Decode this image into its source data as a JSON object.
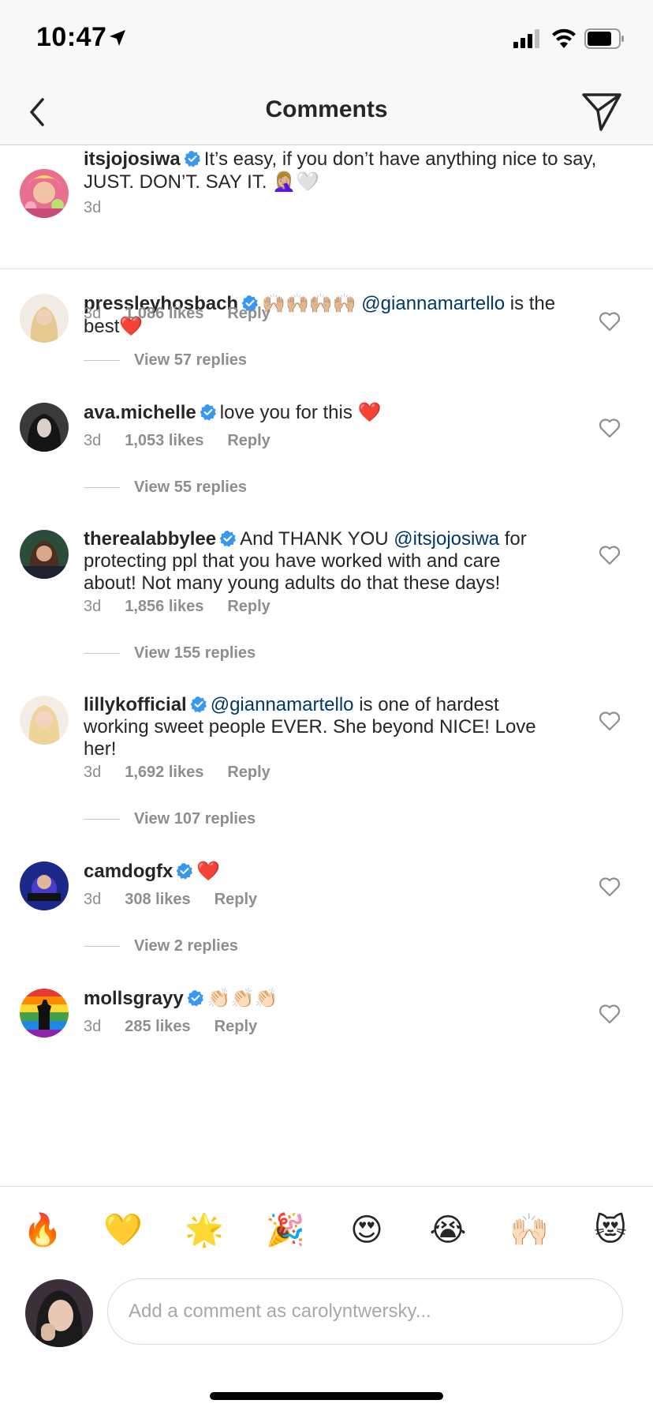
{
  "status_bar": {
    "time": "10:47"
  },
  "nav": {
    "title": "Comments"
  },
  "caption": {
    "username": "itsjojosiwa",
    "text": "It’s easy, if you don’t have anything nice to say, JUST. DON’T. SAY IT.",
    "emoji": "🤦🏼‍♀️🤍",
    "time": "3d"
  },
  "comments": [
    {
      "username": "pressleyhosbach",
      "emoji_lead": "🙌🏼🙌🏼🙌🏼🙌🏼",
      "mention": "@giannamartello",
      "text_after": "is the best",
      "emoji_trail": "❤️",
      "time": "3d",
      "likes": "1,086 likes",
      "reply": "Reply",
      "replies": "View 57 replies"
    },
    {
      "username": "ava.michelle",
      "text": "love you for this",
      "emoji_trail": "❤️",
      "time": "3d",
      "likes": "1,053 likes",
      "reply": "Reply",
      "replies": "View 55 replies"
    },
    {
      "username": "therealabbylee",
      "text_before": "And THANK YOU",
      "mention": "@itsjojosiwa",
      "text_after": "for protecting ppl that you have worked with and care about! Not many young adults do that these days!",
      "time": "3d",
      "likes": "1,856 likes",
      "reply": "Reply",
      "replies": "View 155 replies"
    },
    {
      "username": "lillykofficial",
      "mention": "@giannamartello",
      "text_after": "is one of hardest working sweet people EVER. She beyond NICE! Love her!",
      "time": "3d",
      "likes": "1,692 likes",
      "reply": "Reply",
      "replies": "View 107 replies"
    },
    {
      "username": "camdogfx",
      "emoji_trail": "❤️",
      "time": "3d",
      "likes": "308 likes",
      "reply": "Reply",
      "replies": "View 2 replies"
    },
    {
      "username": "mollsgrayy",
      "emoji_trail": "👏🏻👏🏻👏🏻",
      "time": "3d",
      "likes": "285 likes",
      "reply": "Reply"
    }
  ],
  "emoji_bar": [
    "🔥",
    "💛",
    "🌟",
    "🎉",
    "😍",
    "😭",
    "🙌🏻",
    "😻"
  ],
  "compose": {
    "placeholder": "Add a comment as carolyntwersky..."
  },
  "colors": {
    "mention": "#00376b",
    "verified": "#3897f0",
    "meta": "#8e8e8e",
    "heart_red": "#ed4956"
  }
}
